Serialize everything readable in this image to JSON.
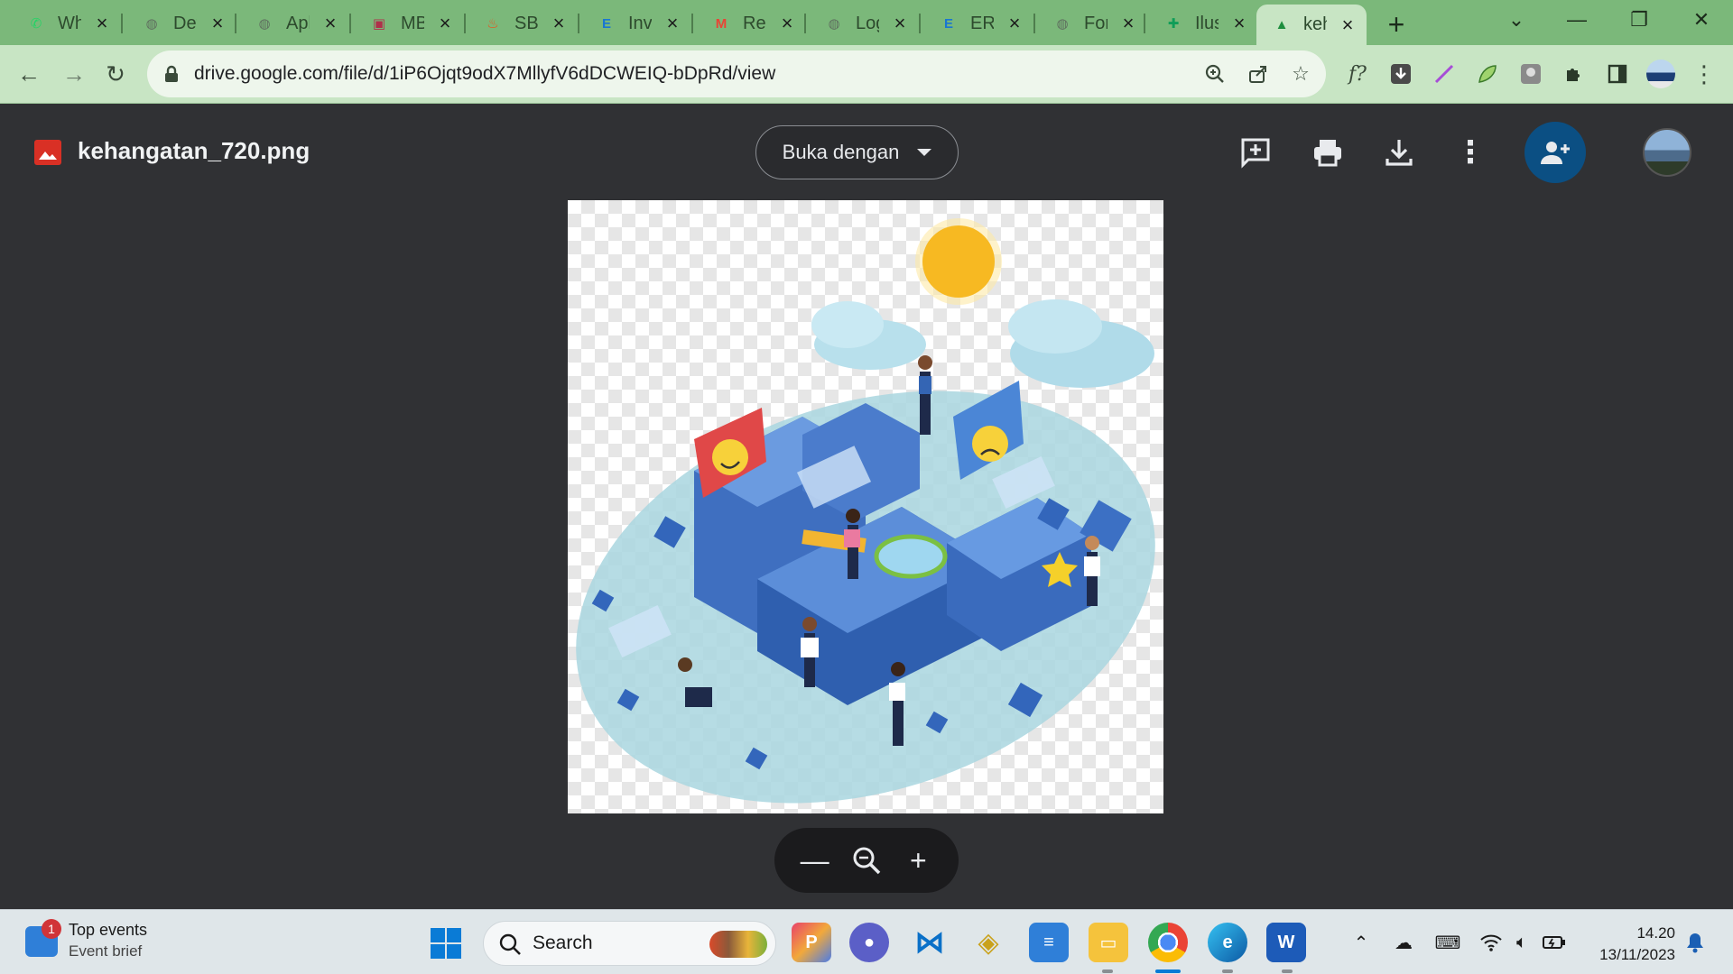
{
  "browser": {
    "tabs": [
      {
        "title": "WhatsApp",
        "icon": "whatsapp-icon",
        "color": "#25d366",
        "glyph": "✆"
      },
      {
        "title": "Detail",
        "icon": "globe-icon",
        "color": "#5f6f5f",
        "glyph": "◍"
      },
      {
        "title": "Aplikasi",
        "icon": "globe-icon",
        "color": "#5f6f5f",
        "glyph": "◍"
      },
      {
        "title": "MBKM",
        "icon": "university-icon",
        "color": "#b0304a",
        "glyph": "▣"
      },
      {
        "title": "SBMPTN",
        "icon": "flame-icon",
        "color": "#e8541e",
        "glyph": "♨"
      },
      {
        "title": "Invoice",
        "icon": "e-icon",
        "color": "#1976d2",
        "glyph": "E"
      },
      {
        "title": "Re:",
        "icon": "gmail-icon",
        "color": "#ea4335",
        "glyph": "M"
      },
      {
        "title": "Login",
        "icon": "globe-icon",
        "color": "#5f6f5f",
        "glyph": "◍"
      },
      {
        "title": "ERP",
        "icon": "e-icon",
        "color": "#1976d2",
        "glyph": "E"
      },
      {
        "title": "Form",
        "icon": "globe-icon",
        "color": "#5f6f5f",
        "glyph": "◍"
      },
      {
        "title": "Ilustrasi",
        "icon": "plus-square-icon",
        "color": "#0f9d58",
        "glyph": "✚"
      },
      {
        "title": "kehangatan",
        "icon": "google-drive-icon",
        "color": "#1e8e3e",
        "glyph": "▲",
        "active": true
      }
    ],
    "url": "drive.google.com/file/d/1iP6Ojqt9odX7MllyfV6dDCWEIQ-bDpRd/view"
  },
  "viewer": {
    "filename": "kehangatan_720.png",
    "open_with_label": "Buka dengan"
  },
  "taskbar": {
    "widget_badge": "1",
    "widget_title": "Top events",
    "widget_subtitle": "Event brief",
    "search_label": "Search",
    "time": "14.20",
    "date": "13/11/2023"
  }
}
